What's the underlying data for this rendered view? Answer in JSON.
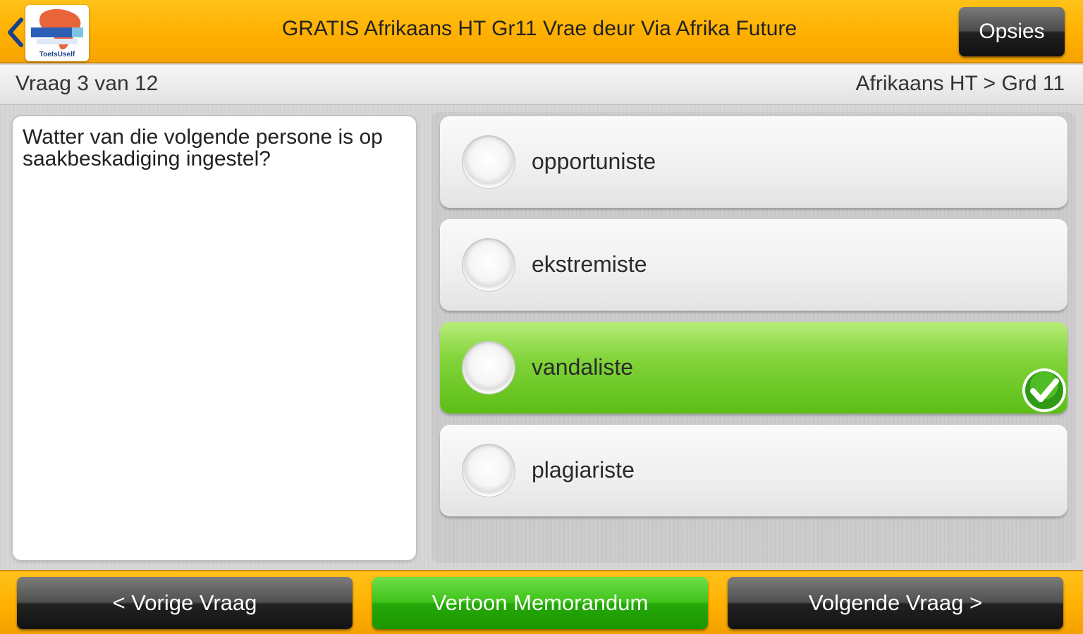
{
  "header": {
    "title": "GRATIS Afrikaans HT Gr11 Vrae deur Via Afrika Future",
    "options_label": "Opsies",
    "logo_text": "ToetsUself",
    "back_icon": "chevron-left-icon",
    "accent_color": "#ffb000"
  },
  "subheader": {
    "question_counter": "Vraag 3 van 12",
    "breadcrumb": "Afrikaans HT > Grd 11"
  },
  "question": {
    "text": "Watter van die volgende persone is op saakbeskadiging ingestel?"
  },
  "answers": [
    {
      "label": "opportuniste",
      "state": "normal"
    },
    {
      "label": "ekstremiste",
      "state": "normal"
    },
    {
      "label": "vandaliste",
      "state": "correct",
      "color": "#6ccb22",
      "marker": "checkmark-icon"
    },
    {
      "label": "plagiariste",
      "state": "normal"
    }
  ],
  "footer": {
    "prev_label": "< Vorige Vraag",
    "memo_label": "Vertoon Memorandum",
    "next_label": "Volgende Vraag >"
  }
}
